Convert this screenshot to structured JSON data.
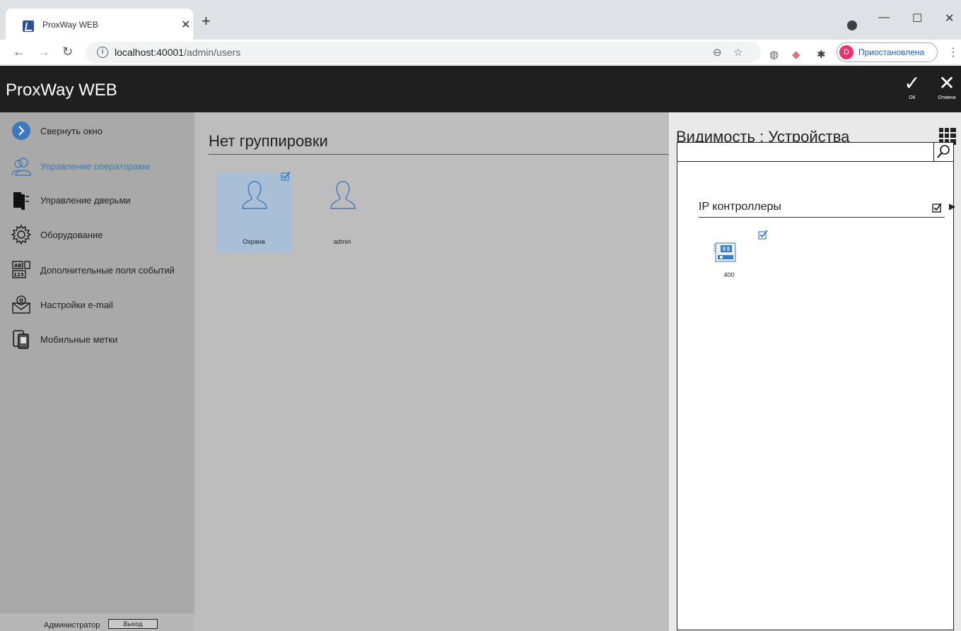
{
  "browser": {
    "tab_title": "ProxWay WEB",
    "url_host": "localhost:40001",
    "url_path": "/admin/users",
    "profile_initial": "D",
    "profile_status": "Приостановлена"
  },
  "app": {
    "title": "ProxWay WEB",
    "ok_label": "ОК",
    "cancel_label": "Отмена"
  },
  "sidebar": {
    "items": [
      {
        "label": "Свернуть окно",
        "icon": "collapse-icon"
      },
      {
        "label": "Управление операторами",
        "icon": "operators-icon"
      },
      {
        "label": "Управление дверьми",
        "icon": "door-icon"
      },
      {
        "label": "Оборудование",
        "icon": "gear-icon"
      },
      {
        "label": "Дополнительные поля событий",
        "icon": "fields-icon"
      },
      {
        "label": "Настройки e-mail",
        "icon": "email-icon"
      },
      {
        "label": "Мобильные метки",
        "icon": "mobile-icon"
      }
    ],
    "active_item": "Управление операторами",
    "footer_user": "Администратор",
    "logout_label": "Выход"
  },
  "main": {
    "group_title": "Нет группировки",
    "users": [
      {
        "name": "Охрана",
        "selected": true,
        "checked": true
      },
      {
        "name": "admin",
        "selected": false,
        "checked": false
      }
    ]
  },
  "visibility_panel": {
    "title": "Видимость : Устройства",
    "search_value": "",
    "section_label": "IP контроллеры",
    "section_checked": true,
    "devices": [
      {
        "name": "400",
        "checked": true
      }
    ]
  },
  "colors": {
    "header_bg": "#1f1f1f",
    "sidebar_bg": "#a9a9a9",
    "main_bg": "#bdbdbd",
    "accent": "#3b7abf",
    "selected_card": "#a8bfd5"
  }
}
